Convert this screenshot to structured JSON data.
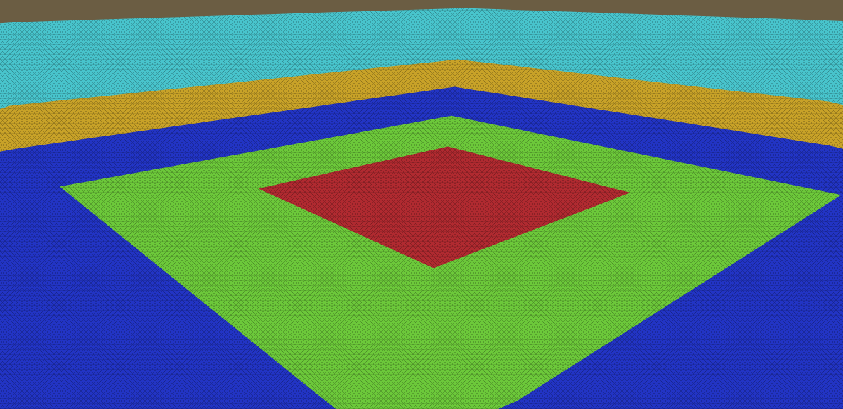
{
  "viewport": {
    "lod_levels": [
      {
        "color": "#b02a30"
      },
      {
        "color": "#6cc83a"
      },
      {
        "color": "#2234c4"
      },
      {
        "color": "#c8a228"
      },
      {
        "color": "#48c4cc"
      }
    ]
  }
}
